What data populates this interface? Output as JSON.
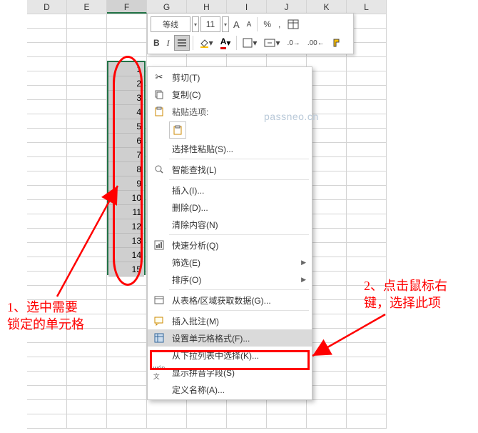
{
  "columns": [
    {
      "label": "D",
      "w": 56
    },
    {
      "label": "E",
      "w": 56
    },
    {
      "label": "F",
      "w": 56,
      "selected": true
    },
    {
      "label": "G",
      "w": 56
    },
    {
      "label": "H",
      "w": 56
    },
    {
      "label": "I",
      "w": 56
    },
    {
      "label": "J",
      "w": 56
    },
    {
      "label": "K",
      "w": 56
    },
    {
      "label": "L",
      "w": 56
    }
  ],
  "selected_values": [
    "1",
    "2",
    "3",
    "4",
    "5",
    "6",
    "7",
    "8",
    "9",
    "10",
    "11",
    "12",
    "13",
    "14",
    "15"
  ],
  "mini_toolbar": {
    "font_name": "等线",
    "font_size": "11",
    "grow_A": "A",
    "shrink_A": "A",
    "bold": "B",
    "italic": "I",
    "percent": "%",
    "comma": ","
  },
  "context_menu": {
    "cut": "剪切(T)",
    "copy": "复制(C)",
    "paste_options_header": "粘贴选项:",
    "paste_special": "选择性粘贴(S)...",
    "smart_lookup": "智能查找(L)",
    "insert": "插入(I)...",
    "delete": "删除(D)...",
    "clear": "清除内容(N)",
    "quick_analysis": "快速分析(Q)",
    "filter": "筛选(E)",
    "sort": "排序(O)",
    "get_data": "从表格/区域获取数据(G)...",
    "insert_comment": "插入批注(M)",
    "format_cells": "设置单元格格式(F)...",
    "pick_from_list": "从下拉列表中选择(K)...",
    "show_pinyin": "显示拼音字段(S)",
    "define_name": "定义名称(A)..."
  },
  "annotations": {
    "a1_line1": "1、选中需要",
    "a1_line2": "锁定的单元格",
    "a2_line1": "2、点击鼠标右",
    "a2_line2": "键，选择此项"
  },
  "watermark": "passneo.cn"
}
